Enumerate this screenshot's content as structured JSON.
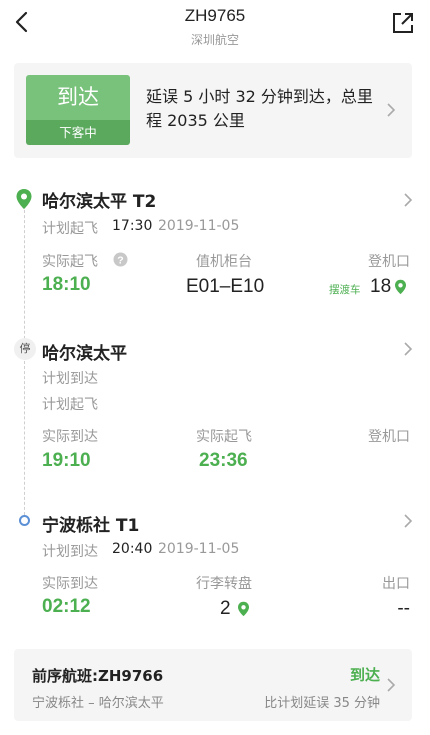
{
  "header": {
    "flight_no": "ZH9765",
    "airline": "深圳航空"
  },
  "status": {
    "state": "到达",
    "sub_state": "下客中",
    "description": "延误 5 小时 32 分钟到达，总里程 2035 公里"
  },
  "departure": {
    "airport": "哈尔滨太平 T2",
    "planned_label": "计划起飞",
    "planned_time": "17:30",
    "planned_date": "2019-11-05",
    "actual_label": "实际起飞",
    "actual_time": "18:10",
    "counter_label": "值机柜台",
    "counter_value": "E01–E10",
    "gate_label": "登机口",
    "gate_tag": "摆渡车",
    "gate_value": "18"
  },
  "stopover": {
    "badge": "停",
    "airport": "哈尔滨太平",
    "planned_arr_label": "计划到达",
    "planned_dep_label": "计划起飞",
    "actual_arr_label": "实际到达",
    "actual_arr_time": "19:10",
    "actual_dep_label": "实际起飞",
    "actual_dep_time": "23:36",
    "gate_label": "登机口"
  },
  "arrival": {
    "airport": "宁波栎社 T1",
    "planned_label": "计划到达",
    "planned_time": "20:40",
    "planned_date": "2019-11-05",
    "actual_label": "实际到达",
    "actual_time": "02:12",
    "baggage_label": "行李转盘",
    "baggage_value": "2",
    "exit_label": "出口",
    "exit_value": "--"
  },
  "previous_flight": {
    "title": "前序航班:ZH9766",
    "route": "宁波栎社 – 哈尔滨太平",
    "status": "到达",
    "delay": "比计划延误 35 分钟"
  },
  "colors": {
    "green": "#4caf50",
    "status_green": "#79c27b",
    "status_green_dark": "#5aa95d",
    "arrival_dot": "#5b8fd6"
  }
}
